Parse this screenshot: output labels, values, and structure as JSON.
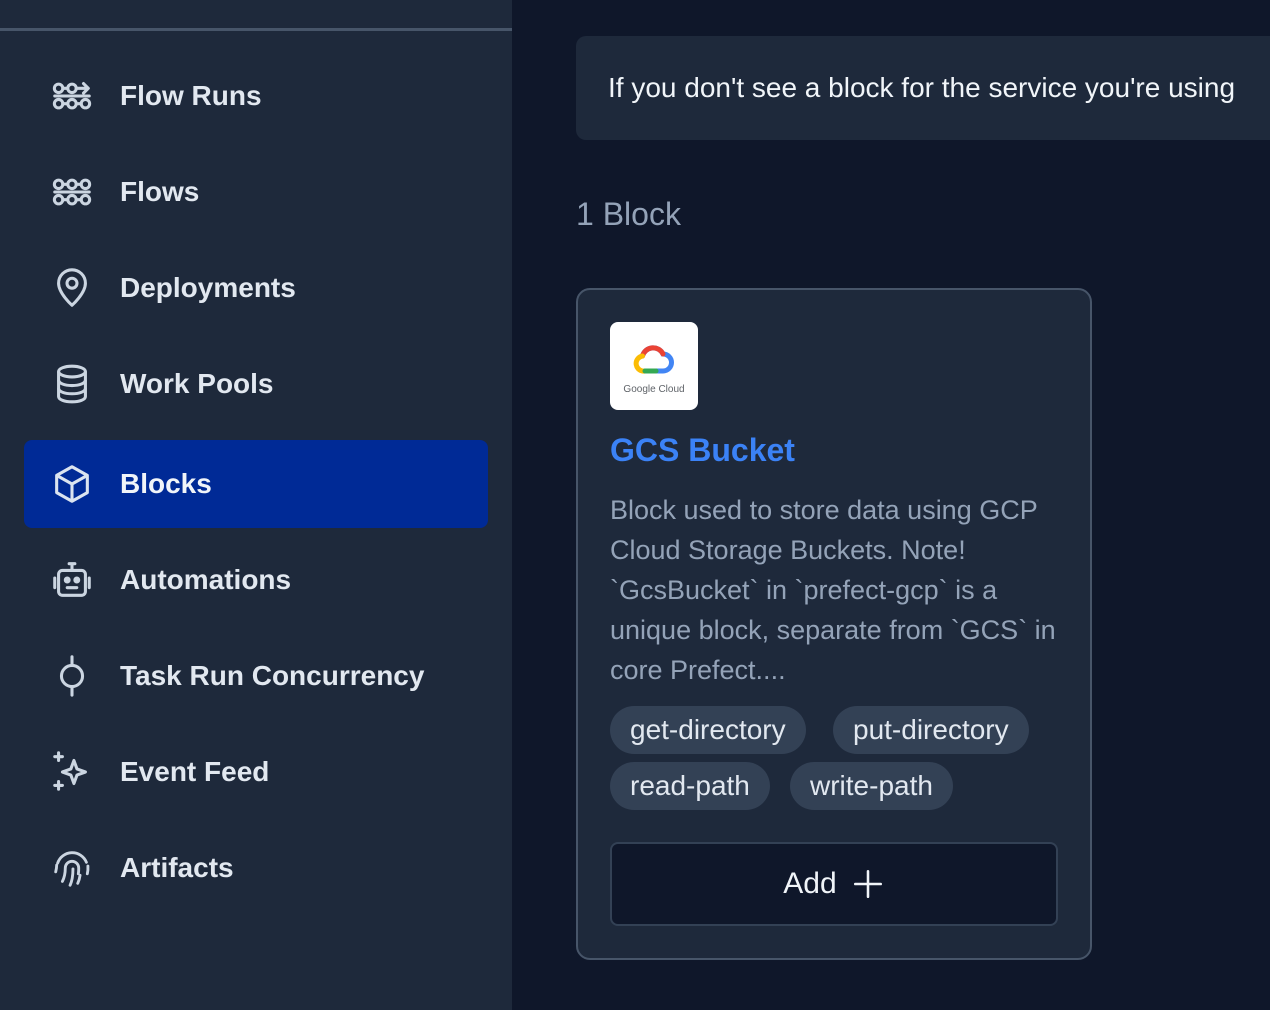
{
  "sidebar": {
    "items": [
      {
        "label": "Flow Runs",
        "icon": "flow-runs-icon"
      },
      {
        "label": "Flows",
        "icon": "flows-icon"
      },
      {
        "label": "Deployments",
        "icon": "map-pin-icon"
      },
      {
        "label": "Work Pools",
        "icon": "database-icon"
      },
      {
        "label": "Blocks",
        "icon": "cube-icon",
        "active": true
      },
      {
        "label": "Automations",
        "icon": "robot-icon"
      },
      {
        "label": "Task Run Concurrency",
        "icon": "concurrency-icon"
      },
      {
        "label": "Event Feed",
        "icon": "sparkles-icon"
      },
      {
        "label": "Artifacts",
        "icon": "fingerprint-icon"
      }
    ]
  },
  "main": {
    "notice": "If you don't see a block for the service you're using",
    "block_count": "1 Block",
    "card": {
      "logo_text": "Google Cloud",
      "title": "GCS Bucket",
      "description": "Block used to store data using GCP Cloud Storage Buckets. Note! `GcsBucket` in `prefect-gcp` is a unique block, separate from `GCS` in core Prefect....",
      "tags": [
        "get-directory",
        "put-directory",
        "read-path",
        "write-path"
      ],
      "add_label": "Add"
    }
  },
  "colors": {
    "sidebar_bg": "#1e293b",
    "main_bg": "#0f172a",
    "active_item": "#002a96",
    "title_link": "#3b82f6"
  }
}
